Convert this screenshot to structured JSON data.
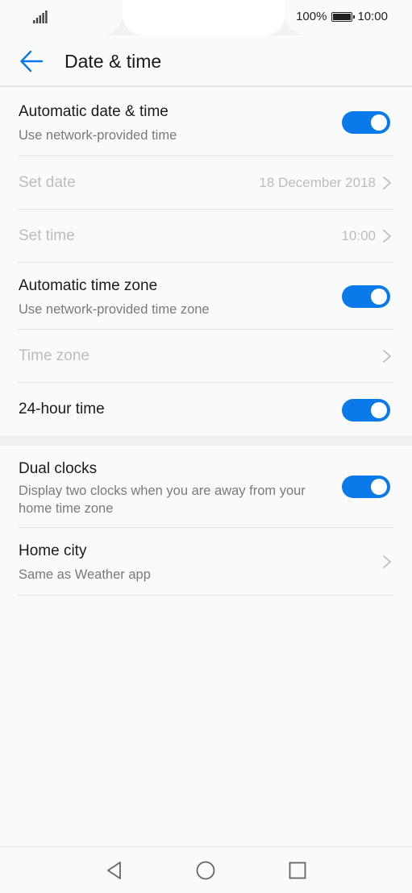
{
  "status": {
    "battery_percent": "100%",
    "time": "10:00"
  },
  "header": {
    "title": "Date & time"
  },
  "settings": {
    "auto_date_time": {
      "label": "Automatic date & time",
      "sub": "Use network-provided time",
      "on": true
    },
    "set_date": {
      "label": "Set date",
      "value": "18 December 2018"
    },
    "set_time": {
      "label": "Set time",
      "value": "10:00"
    },
    "auto_time_zone": {
      "label": "Automatic time zone",
      "sub": "Use network-provided time zone",
      "on": true
    },
    "time_zone": {
      "label": "Time zone"
    },
    "hour24": {
      "label": "24-hour time",
      "on": true
    },
    "dual_clocks": {
      "label": "Dual clocks",
      "sub": "Display two clocks when you are away from your home time zone",
      "on": true
    },
    "home_city": {
      "label": "Home city",
      "sub": "Same as Weather app"
    }
  },
  "colors": {
    "accent": "#0a79e9",
    "disabled_text": "#bdbdbd"
  },
  "icons": {
    "back": "arrow-left-icon",
    "chevron": "chevron-right-icon",
    "nav_back": "triangle-back-icon",
    "nav_home": "circle-home-icon",
    "nav_recent": "square-recent-icon"
  }
}
